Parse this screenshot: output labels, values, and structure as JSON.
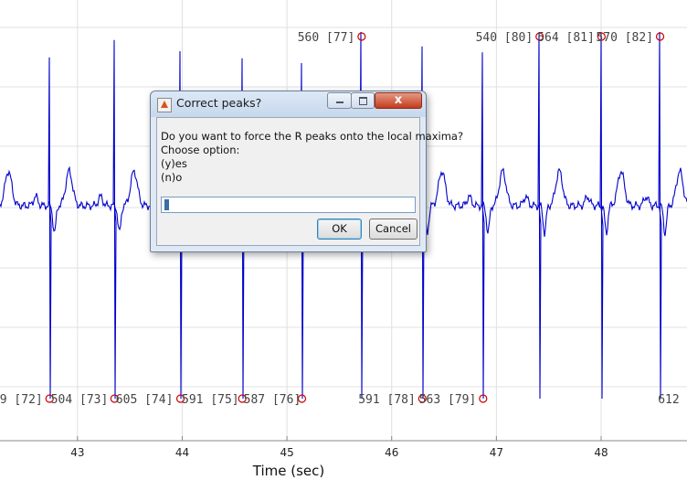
{
  "colors": {
    "signal": "#0000cc",
    "peak_marker": "#cc0000",
    "grid": "#e0e0e0",
    "axis": "#888888"
  },
  "plot": {
    "xlabel": "Time (sec)",
    "xticks": [
      "43",
      "44",
      "45",
      "46",
      "47",
      "48"
    ],
    "xtick_values": [
      43,
      44,
      45,
      46,
      47,
      48
    ],
    "xlim": [
      42.26,
      48.82
    ],
    "peak_labels": [
      {
        "text": "9 [72]",
        "time": 42.72,
        "pos": "bottom",
        "anchor": "end"
      },
      {
        "text": "504 [73]",
        "time": 42.72,
        "pos": "bottom",
        "anchor": "start"
      },
      {
        "text": "605 [74]",
        "time": 43.34,
        "pos": "bottom",
        "anchor": "start"
      },
      {
        "text": "591 [75]",
        "time": 43.97,
        "pos": "bottom",
        "anchor": "start"
      },
      {
        "text": "587 [76]",
        "time": 44.56,
        "pos": "bottom",
        "anchor": "start"
      },
      {
        "text": "560 [77]",
        "time": 45.7,
        "pos": "top",
        "anchor": "end"
      },
      {
        "text": "591 [78]",
        "time": 46.28,
        "pos": "bottom",
        "anchor": "end"
      },
      {
        "text": "563 [79]",
        "time": 46.86,
        "pos": "bottom",
        "anchor": "end"
      },
      {
        "text": "540 [80]",
        "time": 47.4,
        "pos": "top",
        "anchor": "end"
      },
      {
        "text": "564 [81]",
        "time": 47.99,
        "pos": "top",
        "anchor": "end"
      },
      {
        "text": "570 [82]",
        "time": 48.55,
        "pos": "top",
        "anchor": "end"
      },
      {
        "text": "612",
        "time": 48.8,
        "pos": "bottom",
        "anchor": "end"
      }
    ],
    "peaks": [
      {
        "time": 42.72,
        "kind": "low"
      },
      {
        "time": 43.34,
        "kind": "low"
      },
      {
        "time": 43.97,
        "kind": "low"
      },
      {
        "time": 44.56,
        "kind": "low"
      },
      {
        "time": 45.13,
        "kind": "low"
      },
      {
        "time": 45.7,
        "kind": "high"
      },
      {
        "time": 46.28,
        "kind": "low"
      },
      {
        "time": 46.86,
        "kind": "low"
      },
      {
        "time": 47.4,
        "kind": "high"
      },
      {
        "time": 47.99,
        "kind": "high"
      },
      {
        "time": 48.55,
        "kind": "high"
      }
    ]
  },
  "dialog": {
    "title": "Correct peaks?",
    "close_symbol": "x",
    "message_lines": [
      "Do you want to force the R peaks onto the local maxima?",
      "Choose option:",
      "(y)es",
      "(n)o"
    ],
    "input_value": "",
    "ok_label": "OK",
    "cancel_label": "Cancel"
  }
}
